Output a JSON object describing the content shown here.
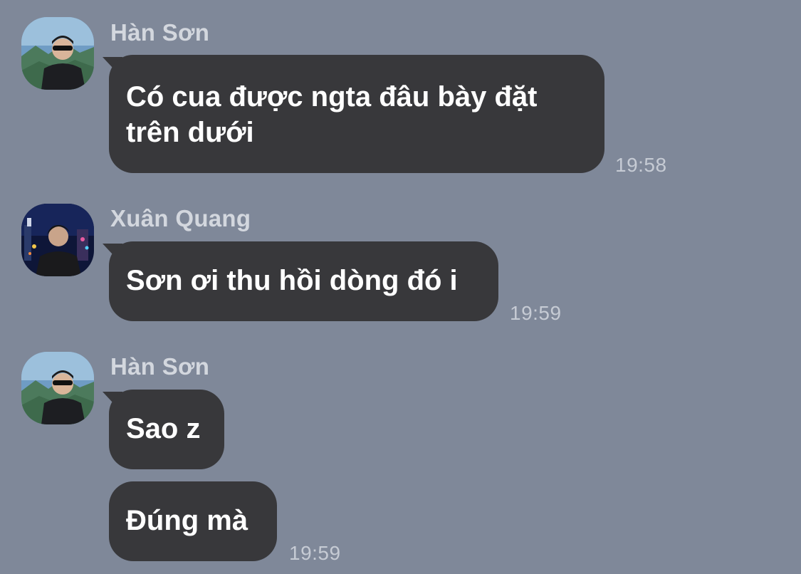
{
  "messages": [
    {
      "sender": "Hàn Sơn",
      "avatar_icon": "mountain-portrait-avatar",
      "bubbles": [
        "Có cua được ngta đâu bày đặt trên dưới"
      ],
      "time": "19:58"
    },
    {
      "sender": "Xuân Quang",
      "avatar_icon": "city-night-portrait-avatar",
      "bubbles": [
        "Sơn ơi thu hồi dòng đó i"
      ],
      "time": "19:59"
    },
    {
      "sender": "Hàn Sơn",
      "avatar_icon": "mountain-portrait-avatar",
      "bubbles": [
        "Sao z",
        "Đúng mà"
      ],
      "time": "19:59"
    }
  ],
  "colors": {
    "background": "#7f8899",
    "bubble": "#38383b",
    "bubble_text": "#ffffff",
    "sender_name": "#d3d7de",
    "timestamp": "#c6cbd4"
  }
}
